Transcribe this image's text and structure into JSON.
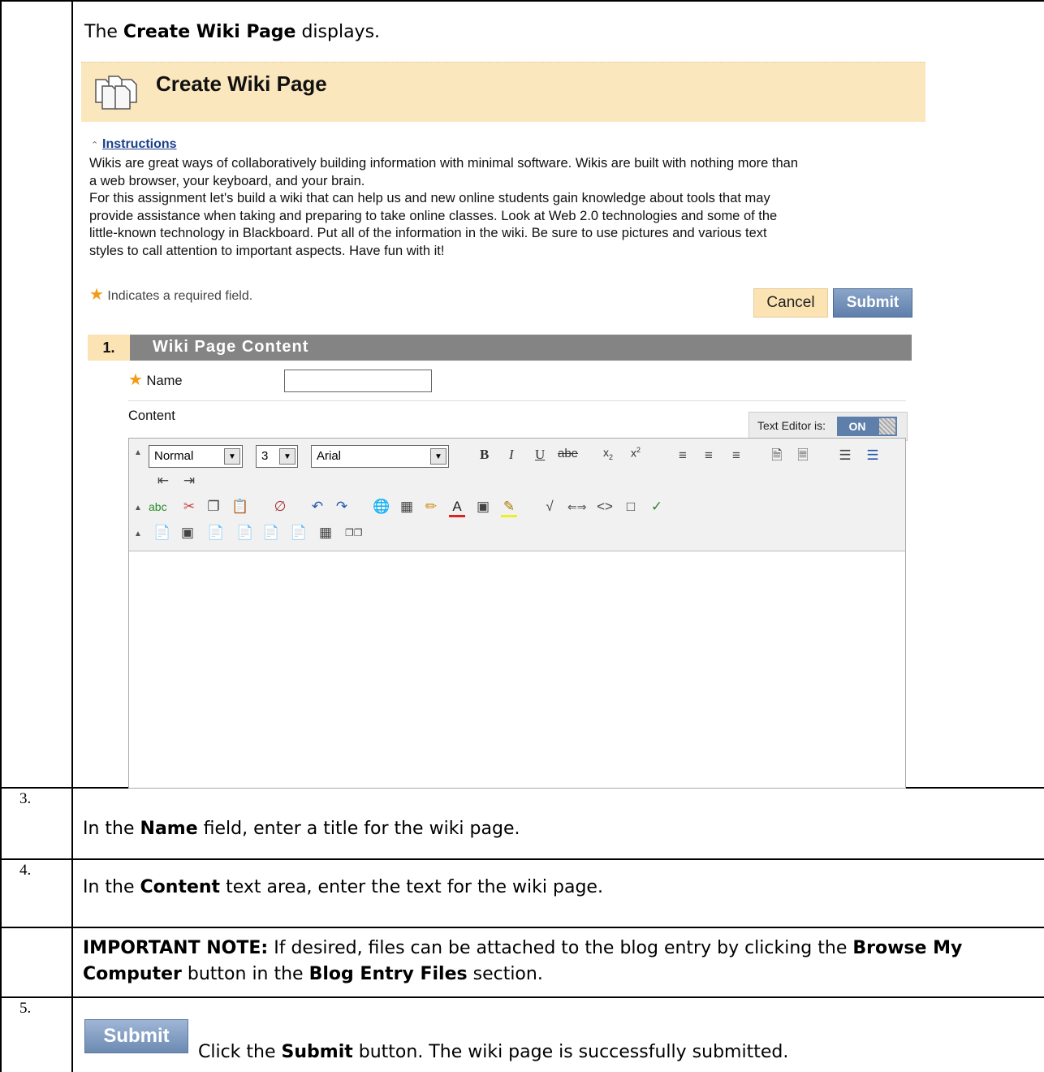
{
  "intro": {
    "pre": "The ",
    "bold": "Create Wiki Page",
    "post": " displays."
  },
  "screenshot": {
    "title": "Create Wiki Page",
    "instructions_link": "Instructions",
    "instructions_lines": [
      "Wikis are great ways of collaboratively building information with minimal software. Wikis are built with nothing more than",
      "a web browser, your keyboard, and your brain.",
      "For this assignment let's build a wiki that can help us and new online students gain knowledge about tools that may",
      "provide assistance when taking and preparing to take online classes. Look at Web 2.0 technologies and some of the",
      "little-known technology in Blackboard. Put all of the information in the wiki. Be sure to use pictures and various text",
      "styles to call attention to important aspects. Have fun with it!"
    ],
    "required_note": "Indicates a required field.",
    "cancel_label": "Cancel",
    "submit_label": "Submit",
    "section_number": "1.",
    "section_title": "Wiki Page Content",
    "name_label": "Name",
    "content_label": "Content",
    "text_editor_label": "Text Editor is:",
    "text_editor_state": "ON",
    "format_select": "Normal",
    "size_select": "3",
    "font_select": "Arial"
  },
  "steps": [
    {
      "num": "3.",
      "pre": "In the ",
      "bold": "Name",
      "post": " field, enter a title for the wiki page."
    },
    {
      "num": "4.",
      "pre": "In the ",
      "bold": "Content",
      "post": " text area, enter the text for the wiki page."
    }
  ],
  "note": {
    "bold1": "IMPORTANT NOTE:",
    "t1": " If desired, files can be attached to the blog entry by clicking the ",
    "bold2": "Browse My",
    "bold3": "Computer",
    "t2": " button in the ",
    "bold4": "Blog Entry Files",
    "t3": " section."
  },
  "step5": {
    "num": "5.",
    "button": "Submit",
    "pre": "Click the ",
    "bold": "Submit",
    "post": " button. The wiki page is successfully submitted."
  }
}
